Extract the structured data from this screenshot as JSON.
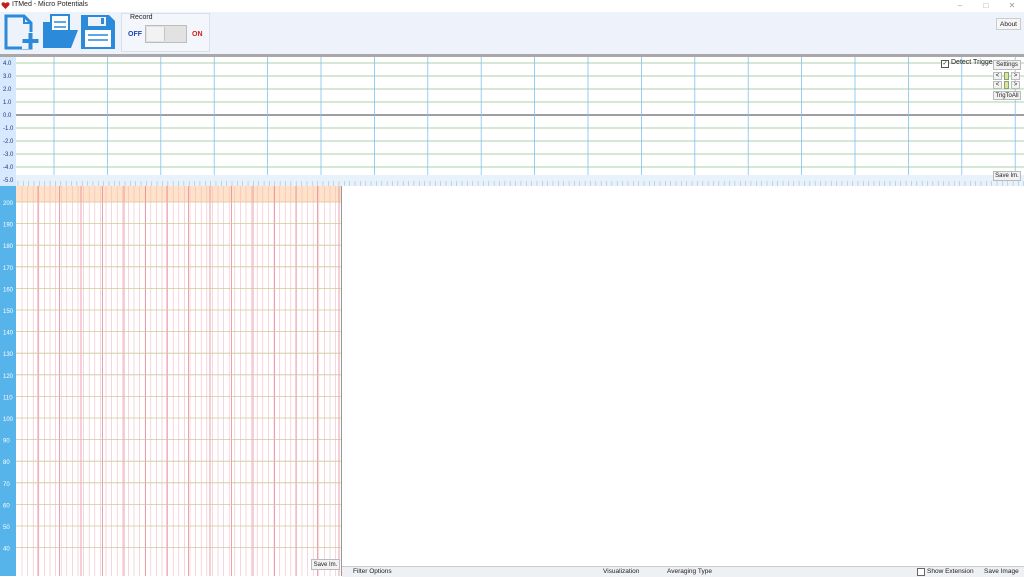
{
  "window": {
    "title": "ITMed - Micro Potentials"
  },
  "toolbar": {
    "new_icon": "new-file-plus-icon",
    "open_icon": "open-folder-icon",
    "save_icon": "save-floppy-icon",
    "record_label": "Record",
    "record_off": "OFF",
    "record_on": "ON",
    "about_label": "About",
    "accent_color": "#2b8ad9"
  },
  "signal_panel": {
    "y_labels": [
      "4.0",
      "3.0",
      "2.0",
      "1.0",
      "0.0",
      "-1.0",
      "-2.0",
      "-3.0",
      "-4.0",
      "-5.0"
    ],
    "detect_trigger_label": "Detect Trigger",
    "detect_trigger_checked": true,
    "settings_label": "Settings",
    "prev_label": "<",
    "next_label": ">",
    "trig_to_all_label": "TrigToAll",
    "save_label": "Save Im."
  },
  "chart_panel": {
    "y_labels": [
      "200",
      "190",
      "180",
      "170",
      "160",
      "150",
      "140",
      "130",
      "120",
      "110",
      "100",
      "90",
      "80",
      "70",
      "60",
      "50",
      "40"
    ],
    "save_label": "Save Im."
  },
  "bottom_bar": {
    "filter_options": "Filter Options",
    "visualization": "Visualization",
    "averaging_type": "Averaging Type",
    "show_extension": "Show Extension",
    "save_image": "Save Image"
  }
}
